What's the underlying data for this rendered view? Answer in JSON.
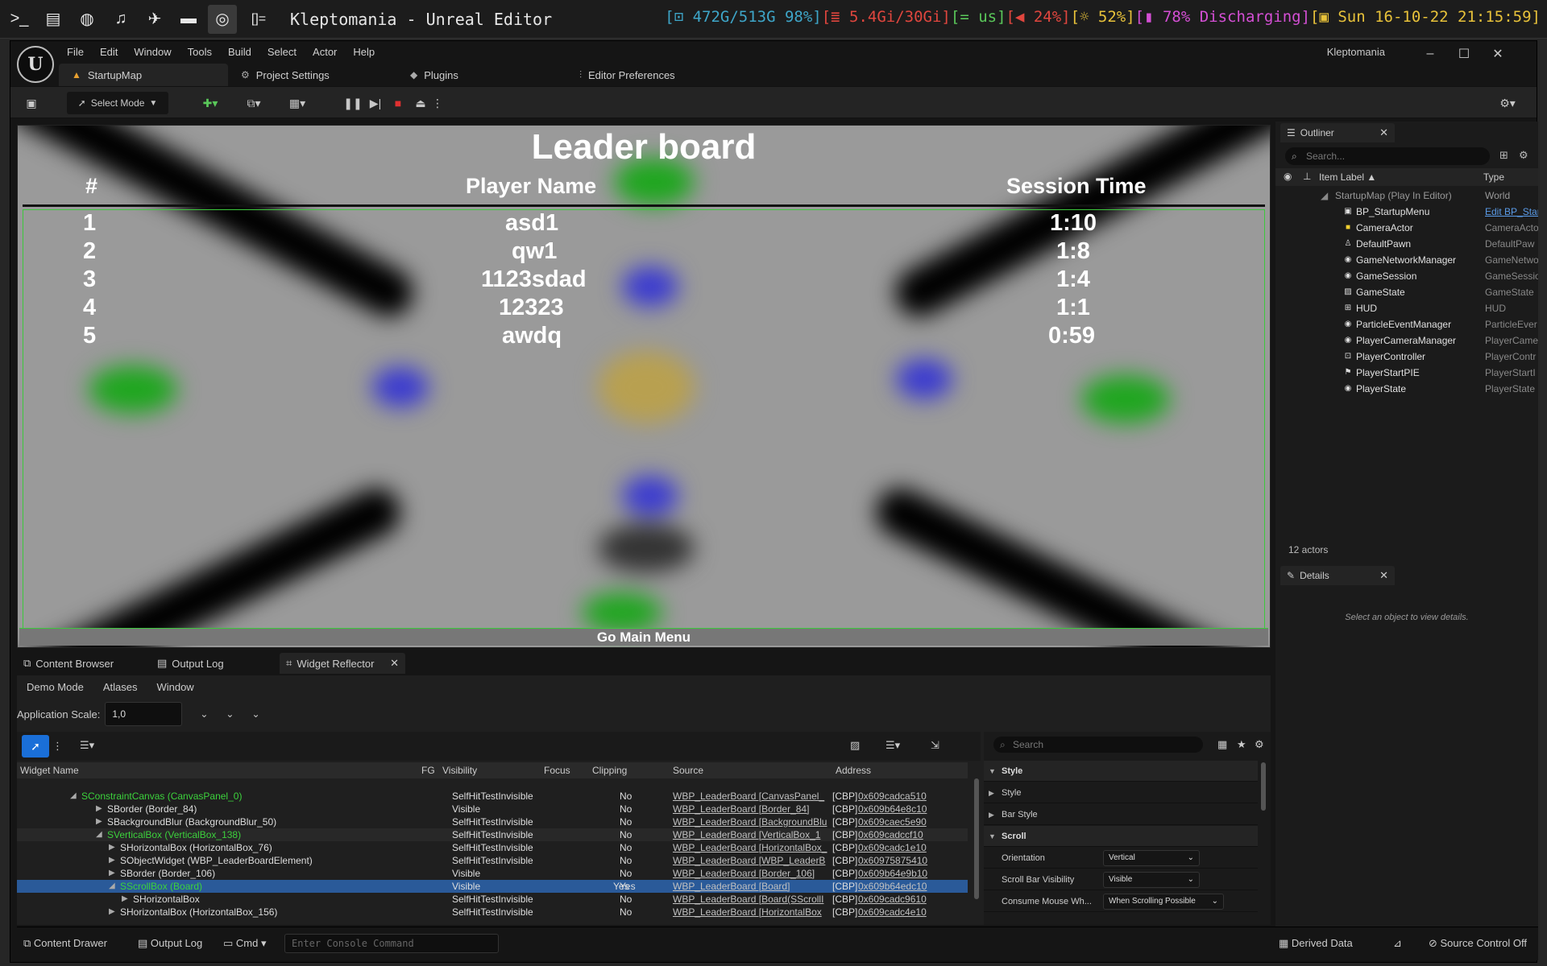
{
  "wm": {
    "title": "Kleptomania - Unreal Editor",
    "disk": "[⊡ 472G/513G 98%]",
    "mem": "[≣ 5.4Gi/30Gi]",
    "kb": "[= us]",
    "vol": "[◀ 24%]",
    "bri": "[☼ 52%]",
    "bat": "[▮ 78% Discharging]",
    "date": "[▣ Sun 16-10-22 21:15:59]"
  },
  "menu": [
    "File",
    "Edit",
    "Window",
    "Tools",
    "Build",
    "Select",
    "Actor",
    "Help"
  ],
  "project_name": "Kleptomania",
  "doc_tabs": [
    "StartupMap",
    "Project Settings",
    "Plugins",
    "Editor Preferences"
  ],
  "toolbar": {
    "select_mode": "Select Mode"
  },
  "leaderboard": {
    "title": "Leader board",
    "col_rank": "#",
    "col_name": "Player Name",
    "col_time": "Session Time",
    "rows": [
      {
        "rank": "1",
        "name": "asd1",
        "time": "1:10"
      },
      {
        "rank": "2",
        "name": "qw1",
        "time": "1:8"
      },
      {
        "rank": "3",
        "name": "1123sdad",
        "time": "1:4"
      },
      {
        "rank": "4",
        "name": "12323",
        "time": "1:1"
      },
      {
        "rank": "5",
        "name": "awdq",
        "time": "0:59"
      }
    ],
    "button": "Go Main Menu"
  },
  "outliner": {
    "tab": "Outliner",
    "search_placeholder": "Search...",
    "col_label": "Item Label ▲",
    "col_type": "Type",
    "root": {
      "label": "StartupMap (Play In Editor)",
      "type": "World"
    },
    "items": [
      {
        "label": "BP_StartupMenu",
        "type": "Edit BP_Star",
        "icon": "widget-icon"
      },
      {
        "label": "CameraActor",
        "type": "CameraActo",
        "icon": "camera-icon"
      },
      {
        "label": "DefaultPawn",
        "type": "DefaultPaw",
        "icon": "pawn-icon"
      },
      {
        "label": "GameNetworkManager",
        "type": "GameNetwo",
        "icon": "actor-icon"
      },
      {
        "label": "GameSession",
        "type": "GameSessio",
        "icon": "actor-icon"
      },
      {
        "label": "GameState",
        "type": "GameState",
        "icon": "state-icon"
      },
      {
        "label": "HUD",
        "type": "HUD",
        "icon": "hud-icon"
      },
      {
        "label": "ParticleEventManager",
        "type": "ParticleEver",
        "icon": "actor-icon"
      },
      {
        "label": "PlayerCameraManager",
        "type": "PlayerCame",
        "icon": "actor-icon"
      },
      {
        "label": "PlayerController",
        "type": "PlayerContr",
        "icon": "controller-icon"
      },
      {
        "label": "PlayerStartPIE",
        "type": "PlayerStartI",
        "icon": "start-icon"
      },
      {
        "label": "PlayerState",
        "type": "PlayerState",
        "icon": "actor-icon"
      }
    ],
    "count": "12 actors"
  },
  "details": {
    "tab": "Details",
    "empty": "Select an object to view details."
  },
  "bottom_tabs": [
    "Content Browser",
    "Output Log",
    "Widget Reflector"
  ],
  "reflector": {
    "menu": [
      "Demo Mode",
      "Atlases",
      "Window"
    ],
    "scale_label": "Application Scale:",
    "scale_value": "1,0",
    "headers": [
      "Widget Name",
      "FG",
      "Visibility",
      "Focus",
      "Clipping",
      "Source",
      "Address"
    ],
    "rows": [
      {
        "name": "SConstraintCanvas (CanvasPanel_0)",
        "vis": "SelfHitTestInvisible",
        "focus": "",
        "clip": "No",
        "src": "WBP_LeaderBoard [CanvasPanel_",
        "cbp": "[CBP]",
        "addr": "0x609cadca510"
      },
      {
        "name": "SBorder (Border_84)",
        "vis": "Visible",
        "focus": "",
        "clip": "No",
        "src": "WBP_LeaderBoard [Border_84]",
        "cbp": "[CBP]",
        "addr": "0x609b64e8c10"
      },
      {
        "name": "SBackgroundBlur (BackgroundBlur_50)",
        "vis": "SelfHitTestInvisible",
        "focus": "",
        "clip": "No",
        "src": "WBP_LeaderBoard [BackgroundBlu",
        "cbp": "[CBP]",
        "addr": "0x609caec5e90"
      },
      {
        "name": "SVerticalBox (VerticalBox_138)",
        "vis": "SelfHitTestInvisible",
        "focus": "",
        "clip": "No",
        "src": "WBP_LeaderBoard [VerticalBox_1",
        "cbp": "[CBP]",
        "addr": "0x609cadccf10"
      },
      {
        "name": "SHorizontalBox (HorizontalBox_76)",
        "vis": "SelfHitTestInvisible",
        "focus": "",
        "clip": "No",
        "src": "WBP_LeaderBoard [HorizontalBox_",
        "cbp": "[CBP]",
        "addr": "0x609cadc1e10"
      },
      {
        "name": "SObjectWidget (WBP_LeaderBoardElement)",
        "vis": "SelfHitTestInvisible",
        "focus": "",
        "clip": "No",
        "src": "WBP_LeaderBoard [WBP_LeaderB",
        "cbp": "[CBP]",
        "addr": "0x60975875410"
      },
      {
        "name": "SBorder (Border_106)",
        "vis": "Visible",
        "focus": "",
        "clip": "No",
        "src": "WBP_LeaderBoard [Border_106]",
        "cbp": "[CBP]",
        "addr": "0x609b64e9b10"
      },
      {
        "name": "SScrollBox (Board)",
        "vis": "Visible",
        "focus": "Yes",
        "clip": "Yes",
        "src": "WBP_LeaderBoard [Board]",
        "cbp": "[CBP]",
        "addr": "0x609b64edc10"
      },
      {
        "name": "SHorizontalBox",
        "vis": "SelfHitTestInvisible",
        "focus": "",
        "clip": "No",
        "src": "WBP_LeaderBoard [Board(SScrollI",
        "cbp": "[CBP]",
        "addr": "0x609cadc9610"
      },
      {
        "name": "SHorizontalBox (HorizontalBox_156)",
        "vis": "SelfHitTestInvisible",
        "focus": "",
        "clip": "No",
        "src": "WBP_LeaderBoard [HorizontalBox",
        "cbp": "[CBP]",
        "addr": "0x609cadc4e10"
      }
    ],
    "props_search": "Search",
    "props": [
      {
        "cat": true,
        "label": "Style"
      },
      {
        "cat": false,
        "label": "Style"
      },
      {
        "cat": false,
        "label": "Bar Style"
      },
      {
        "cat": true,
        "label": "Scroll"
      },
      {
        "cat": false,
        "label": "Orientation",
        "value": "Vertical"
      },
      {
        "cat": false,
        "label": "Scroll Bar Visibility",
        "value": "Visible"
      },
      {
        "cat": false,
        "label": "Consume Mouse Wh...",
        "value": "When Scrolling Possible"
      }
    ]
  },
  "statusbar": {
    "content_drawer": "Content Drawer",
    "output_log": "Output Log",
    "cmd": "Cmd",
    "console_placeholder": "Enter Console Command",
    "derived_data": "Derived Data",
    "source_control": "Source Control Off"
  }
}
